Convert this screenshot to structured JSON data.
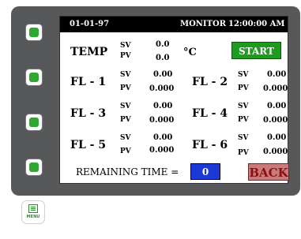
{
  "topbar": {
    "date": "01-01-97",
    "title": "MONITOR",
    "time": "12:00:00 AM"
  },
  "temp": {
    "label": "TEMP",
    "sv_tag": "SV",
    "pv_tag": "PV",
    "sv": "0.0",
    "pv": "0.0",
    "unit": "°C"
  },
  "start_label": "START",
  "flows": [
    {
      "label": "FL - 1",
      "sv": "0.00",
      "pv": "0.000"
    },
    {
      "label": "FL - 2",
      "sv": "0.00",
      "pv": "0.000"
    },
    {
      "label": "FL - 3",
      "sv": "0.00",
      "pv": "0.000"
    },
    {
      "label": "FL - 4",
      "sv": "0.00",
      "pv": "0.000"
    },
    {
      "label": "FL - 5",
      "sv": "0.00",
      "pv": "0.000"
    },
    {
      "label": "FL - 6",
      "sv": "0.00",
      "pv": "0.000"
    }
  ],
  "tags": {
    "sv": "SV",
    "pv": "PV"
  },
  "remaining": {
    "label": "REMAINING TIME =",
    "value": "0"
  },
  "back_label": "BACK",
  "menu_label": "MENU",
  "colors": {
    "panel": "#56585a",
    "start": "#1e9a1e",
    "time_box": "#1c39d6",
    "back": "#c97a7a",
    "side_button": "#2ea82e"
  },
  "icons": {
    "side_buttons": "green-square-icon",
    "menu": "menu-document-icon"
  }
}
